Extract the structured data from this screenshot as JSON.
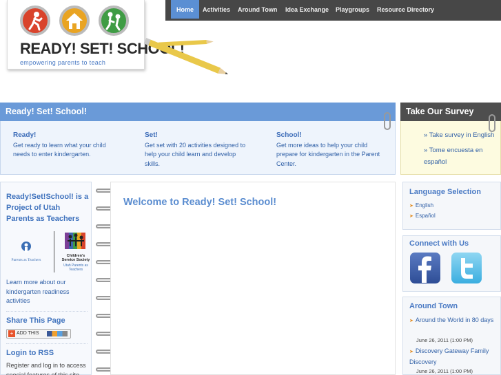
{
  "nav": {
    "items": [
      "Home",
      "Activities",
      "Around Town",
      "Idea Exchange",
      "Playgroups",
      "Resource Directory"
    ]
  },
  "logo": {
    "title": "READY! SET! SCHOOL!",
    "tagline": "empowering parents to teach"
  },
  "banner": {
    "main_title": "Ready! Set! School!",
    "survey_title": "Take Our Survey"
  },
  "intro": [
    {
      "heading": "Ready!",
      "text": "Get ready to learn what your child needs to enter kindergarten."
    },
    {
      "heading": "Set!",
      "text": "Get set with 20 activities designed to help your child learn and develop skills."
    },
    {
      "heading": "School!",
      "text": "Get more ideas to help your child prepare for kindergarten in the Parent Center."
    }
  ],
  "survey": {
    "links": [
      "» Take survey in English",
      "» Tome encuesta en español"
    ]
  },
  "left": {
    "project_title": "Ready!Set!School! is a Project of Utah Parents as Teachers",
    "logo1_label": "Parents as Teachers",
    "logo2_label_1": "Children's",
    "logo2_label_2": "Service Society",
    "logo2_label_3": "Utah Parents as Teachers",
    "learn_more": "Learn more about our kindergarten readiness activities",
    "share_heading": "Share This Page",
    "addthis_label": "ADD THIS",
    "login_heading": "Login to RSS",
    "login_text": "Register and log in to access special features of this site."
  },
  "main": {
    "welcome": "Welcome to Ready! Set! School!"
  },
  "right": {
    "language_heading": "Language Selection",
    "languages": [
      "English",
      "Español"
    ],
    "connect_heading": "Connect with Us",
    "around_heading": "Around Town",
    "events": [
      {
        "title": "Around the World in 80 days",
        "date": "June 26, 2011 (1:00 PM)"
      },
      {
        "title": "Discovery Gateway Family Discovery",
        "date": "June 26, 2011 (1:00 PM)"
      }
    ]
  },
  "colors": {
    "nav_bg": "#474747",
    "nav_active": "#5b8fd3",
    "banner_blue": "#6a9ad8",
    "banner_dark": "#4e4e4e",
    "heading_blue": "#3f72bd",
    "link_blue": "#2f5fa6",
    "arrow_orange": "#e08a1e"
  }
}
